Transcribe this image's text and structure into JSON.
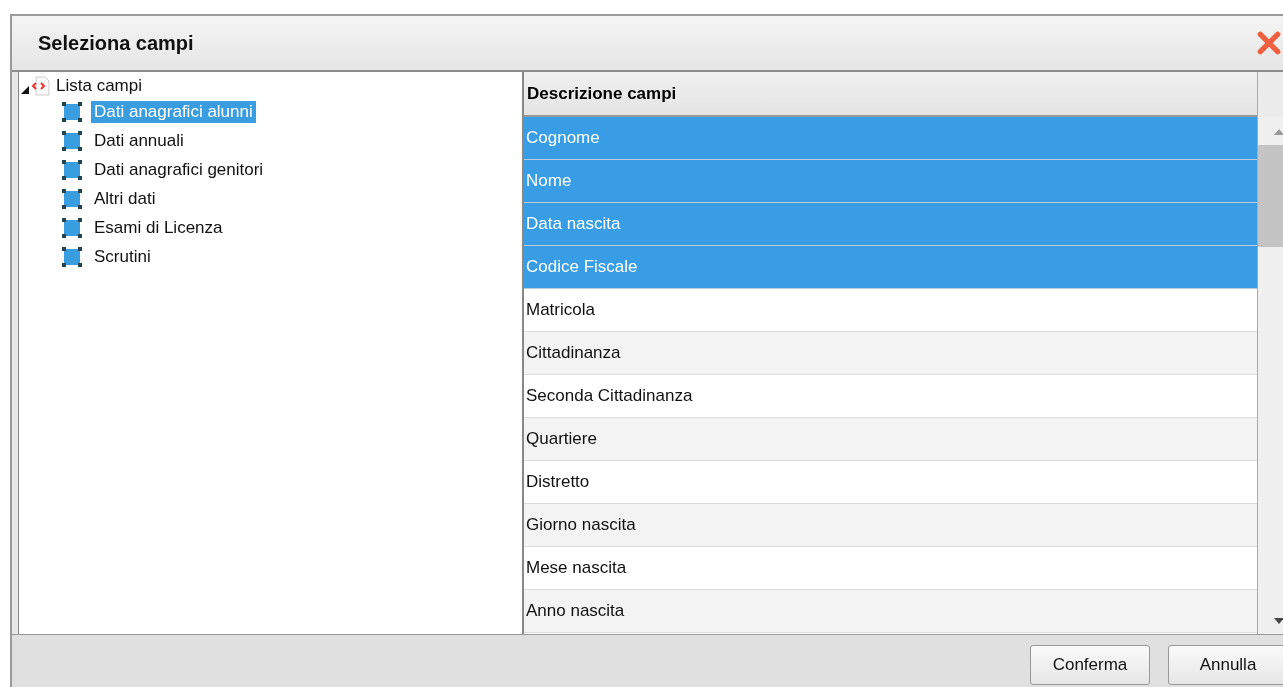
{
  "window": {
    "title": "Seleziona campi"
  },
  "tree": {
    "label": "Lista campi",
    "expanded": true,
    "children": [
      {
        "label": "Dati anagrafici alunni",
        "selected": true
      },
      {
        "label": "Dati annuali",
        "selected": false
      },
      {
        "label": "Dati anagrafici genitori",
        "selected": false
      },
      {
        "label": "Altri dati",
        "selected": false
      },
      {
        "label": "Esami di Licenza",
        "selected": false
      },
      {
        "label": "Scrutini",
        "selected": false
      }
    ]
  },
  "table": {
    "columns": [
      "Descrizione campi"
    ],
    "rows": [
      {
        "label": "Cognome",
        "selected": true
      },
      {
        "label": "Nome",
        "selected": true
      },
      {
        "label": "Data nascita",
        "selected": true
      },
      {
        "label": "Codice Fiscale",
        "selected": true
      },
      {
        "label": "Matricola",
        "selected": false
      },
      {
        "label": "Cittadinanza",
        "selected": false
      },
      {
        "label": "Seconda Cittadinanza",
        "selected": false
      },
      {
        "label": "Quartiere",
        "selected": false
      },
      {
        "label": "Distretto",
        "selected": false
      },
      {
        "label": "Giorno nascita",
        "selected": false
      },
      {
        "label": "Mese nascita",
        "selected": false
      },
      {
        "label": "Anno nascita",
        "selected": false
      }
    ]
  },
  "buttons": [
    "Conferma",
    "Annulla"
  ]
}
